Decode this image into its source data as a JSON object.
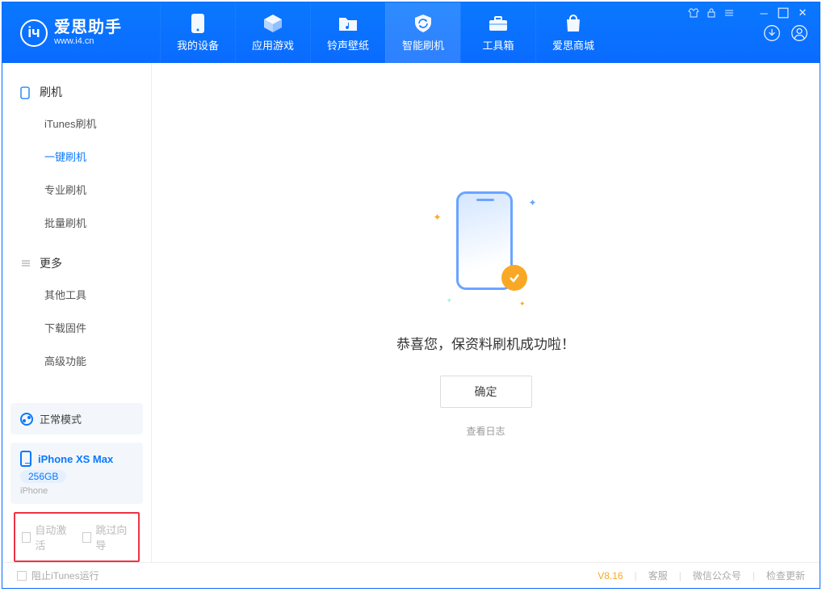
{
  "app": {
    "title": "爱思助手",
    "subtitle": "www.i4.cn",
    "version": "V8.16"
  },
  "header": {
    "tabs": [
      {
        "label": "我的设备"
      },
      {
        "label": "应用游戏"
      },
      {
        "label": "铃声壁纸"
      },
      {
        "label": "智能刷机"
      },
      {
        "label": "工具箱"
      },
      {
        "label": "爱思商城"
      }
    ]
  },
  "sidebar": {
    "section1_title": "刷机",
    "items1": [
      {
        "label": "iTunes刷机"
      },
      {
        "label": "一键刷机"
      },
      {
        "label": "专业刷机"
      },
      {
        "label": "批量刷机"
      }
    ],
    "section2_title": "更多",
    "items2": [
      {
        "label": "其他工具"
      },
      {
        "label": "下载固件"
      },
      {
        "label": "高级功能"
      }
    ],
    "mode_label": "正常模式",
    "device": {
      "name": "iPhone XS Max",
      "storage": "256GB",
      "type": "iPhone"
    },
    "cb1": "自动激活",
    "cb2": "跳过向导"
  },
  "main": {
    "success_msg": "恭喜您，保资料刷机成功啦！",
    "ok_label": "确定",
    "log_label": "查看日志"
  },
  "footer": {
    "block_itunes": "阻止iTunes运行",
    "links": [
      {
        "label": "客服"
      },
      {
        "label": "微信公众号"
      },
      {
        "label": "检查更新"
      }
    ]
  }
}
